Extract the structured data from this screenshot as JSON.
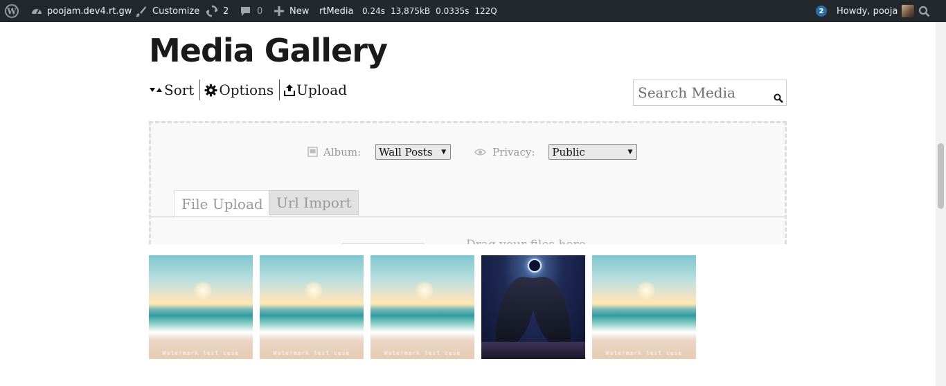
{
  "adminbar": {
    "site_name": "poojam.dev4.rt.gw",
    "customize": "Customize",
    "updates_count": "2",
    "comments_count": "0",
    "new_label": "New",
    "rtmedia": "rtMedia",
    "stats": [
      "0.24s",
      "13,875kB",
      "0.0335s",
      "122Q"
    ],
    "notifications_count": "2",
    "howdy": "Howdy, pooja"
  },
  "page": {
    "title": "Media Gallery"
  },
  "toolbar": {
    "sort": "Sort",
    "options": "Options",
    "upload": "Upload"
  },
  "search": {
    "placeholder": "Search Media"
  },
  "upload": {
    "album_label": "Album:",
    "album_value": "Wall Posts",
    "privacy_label": "Privacy:",
    "privacy_value": "Public",
    "tab_file": "File Upload",
    "tab_url": "Url Import",
    "drop_hint": "Drag your files here"
  },
  "gallery": {
    "watermark": "Watermark test case",
    "items": [
      {
        "kind": "beach"
      },
      {
        "kind": "beach"
      },
      {
        "kind": "beach"
      },
      {
        "kind": "angel"
      },
      {
        "kind": "beach"
      }
    ]
  }
}
